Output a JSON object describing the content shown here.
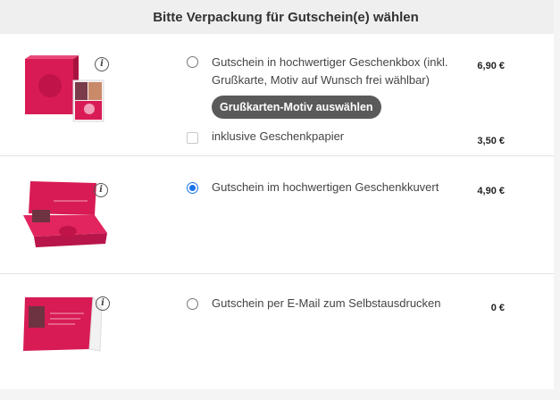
{
  "header": {
    "title": "Bitte Verpackung für Gutschein(e) wählen"
  },
  "options": [
    {
      "label": "Gutschein in hochwertiger Geschenkbox (inkl. Grußkarte, Motiv auf Wunsch frei wählbar)",
      "price": "6,90 €",
      "selected": false,
      "button_label": "Grußkarten-Motiv auswählen",
      "extra_label": "inklusive Geschenkpapier",
      "extra_price": "3,50 €",
      "extra_checked": false
    },
    {
      "label": "Gutschein im hochwertigen Geschenkkuvert",
      "price": "4,90 €",
      "selected": true
    },
    {
      "label": "Gutschein per E-Mail zum Selbstausdrucken",
      "price": "0 €",
      "selected": false
    }
  ],
  "info_icon_glyph": "i",
  "colors": {
    "brand": "#d81b55",
    "radio_selected": "#1a73e8",
    "button": "#5a5a5a"
  }
}
